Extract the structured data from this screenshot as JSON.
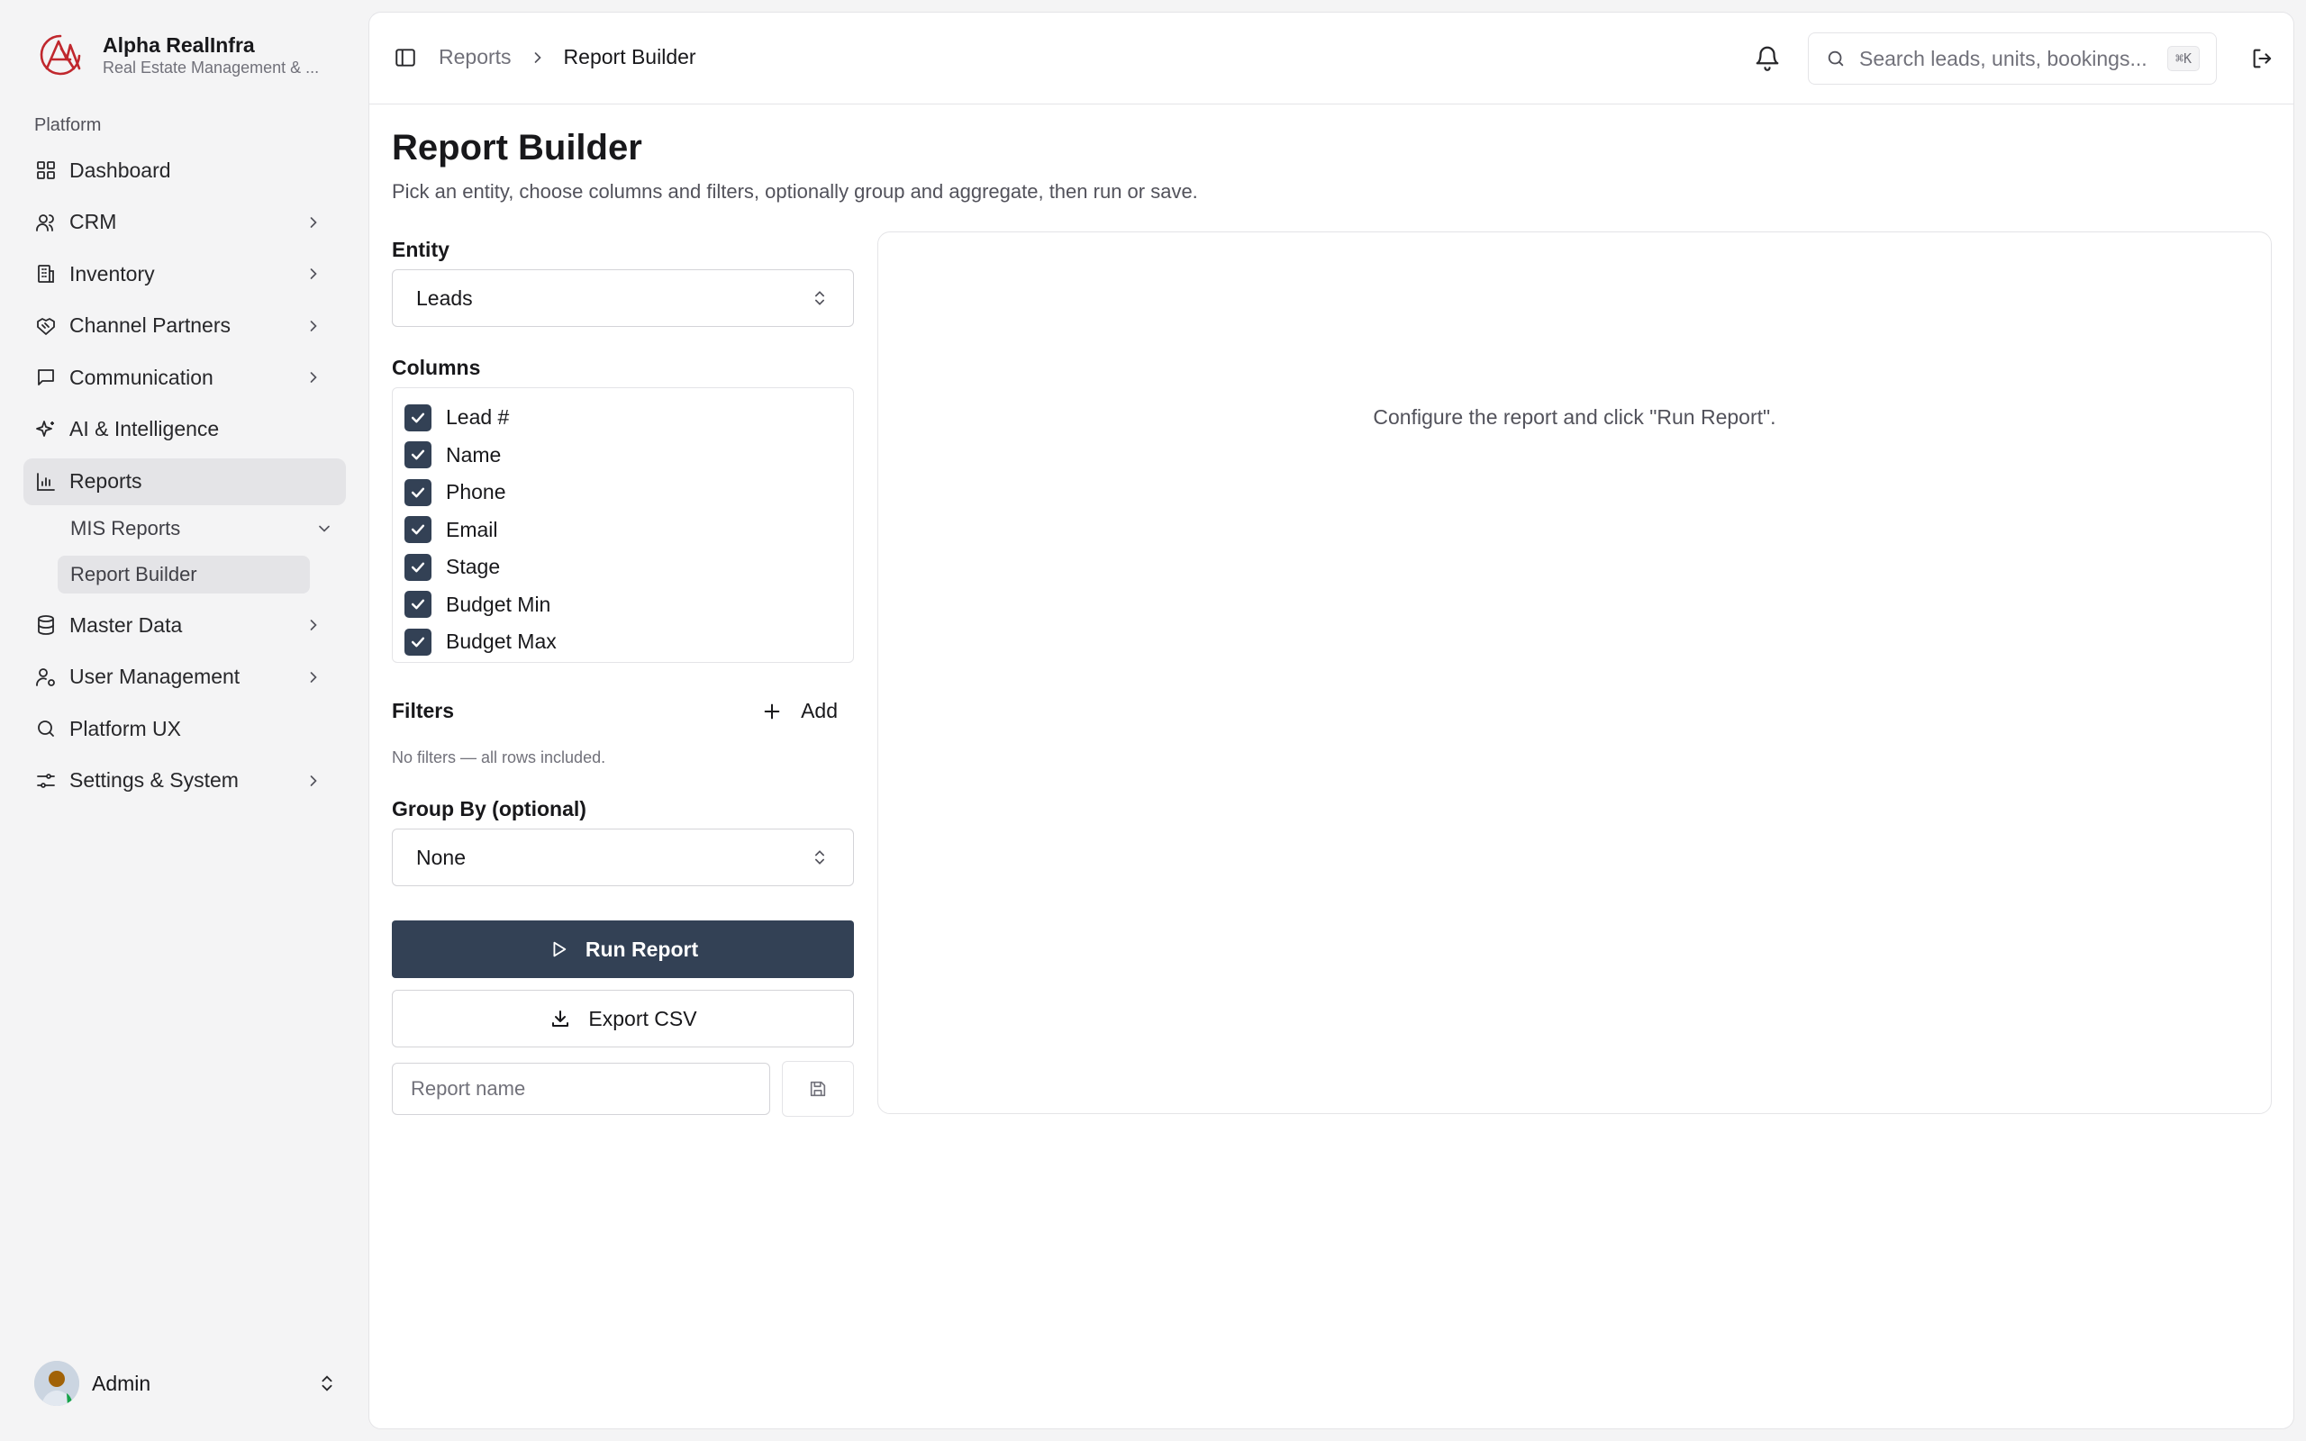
{
  "brand": {
    "name": "Alpha RealInfra",
    "subtitle": "Real Estate Management & ...",
    "accent": "#c0272d"
  },
  "sidebar": {
    "group_label": "Platform",
    "items": [
      {
        "label": "Dashboard",
        "icon": "grid-icon"
      },
      {
        "label": "CRM",
        "icon": "users-icon",
        "has_children": true
      },
      {
        "label": "Inventory",
        "icon": "building-icon",
        "has_children": true
      },
      {
        "label": "Channel Partners",
        "icon": "handshake-icon",
        "has_children": true
      },
      {
        "label": "Communication",
        "icon": "message-square-icon",
        "has_children": true
      },
      {
        "label": "AI & Intelligence",
        "icon": "sparkles-icon"
      },
      {
        "label": "Reports",
        "icon": "bar-chart-icon",
        "active": true
      },
      {
        "label": "Master Data",
        "icon": "database-icon",
        "has_children": true
      },
      {
        "label": "User Management",
        "icon": "user-cog-icon",
        "has_children": true
      },
      {
        "label": "Platform UX",
        "icon": "search-icon"
      },
      {
        "label": "Settings & System",
        "icon": "sliders-icon",
        "has_children": true
      }
    ],
    "sub_items": [
      {
        "label": "MIS Reports",
        "icon": "chevron-down-icon"
      },
      {
        "label": "Report Builder",
        "active": true
      }
    ],
    "user": {
      "name": "Admin"
    }
  },
  "topbar": {
    "breadcrumb": [
      "Reports",
      "Report Builder"
    ],
    "search_placeholder": "Search leads, units, bookings...",
    "search_shortcut": "⌘K"
  },
  "page": {
    "title": "Report Builder",
    "subtitle": "Pick an entity, choose columns and filters, optionally group and aggregate, then run or save."
  },
  "builder": {
    "entity_label": "Entity",
    "entity_value": "Leads",
    "columns_label": "Columns",
    "columns": [
      {
        "label": "Lead #",
        "checked": true
      },
      {
        "label": "Name",
        "checked": true
      },
      {
        "label": "Phone",
        "checked": true
      },
      {
        "label": "Email",
        "checked": true
      },
      {
        "label": "Stage",
        "checked": true
      },
      {
        "label": "Budget Min",
        "checked": true
      },
      {
        "label": "Budget Max",
        "checked": true
      }
    ],
    "filters_label": "Filters",
    "add_label": "Add",
    "filters_empty": "No filters — all rows included.",
    "group_by_label": "Group By (optional)",
    "group_by_value": "None",
    "run_label": "Run Report",
    "export_label": "Export CSV",
    "report_name_placeholder": "Report name"
  },
  "results": {
    "empty_message": "Configure the report and click \"Run Report\"."
  },
  "colors": {
    "primary": "#334155",
    "sidebar_bg": "#f4f4f5",
    "active_bg": "#e4e4e7",
    "border": "#e4e4e7"
  }
}
